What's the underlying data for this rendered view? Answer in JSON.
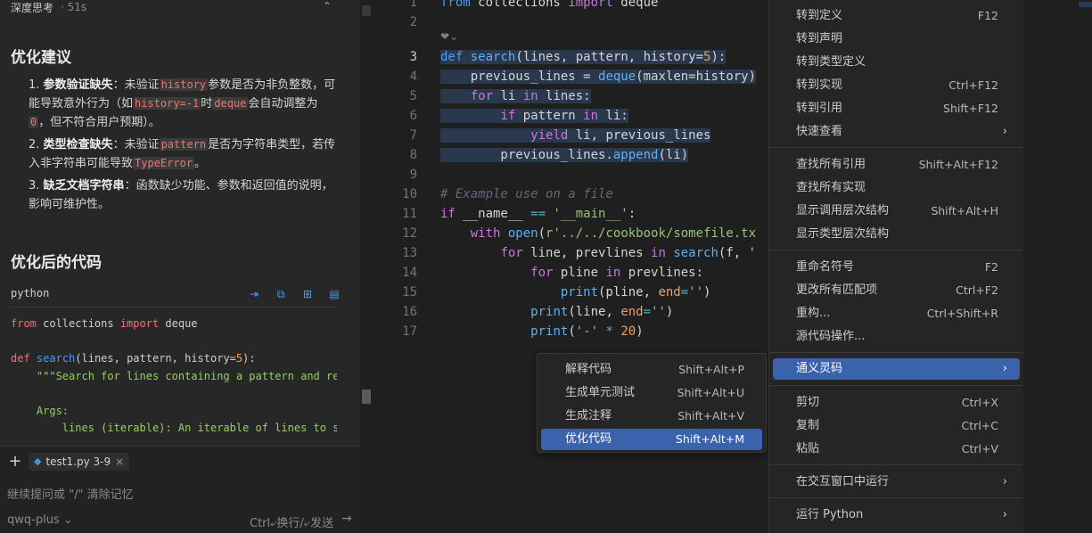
{
  "chat": {
    "thinking_label": "深度思考",
    "thinking_duration": "· 51s",
    "suggestions_heading": "优化建议",
    "suggestions": [
      {
        "num": "1.",
        "title": "参数验证缺失",
        "before": "：未验证",
        "code1": "history",
        "mid1": "参数是否为非负整数，可能导致意外行为（如",
        "code2": "history=-1",
        "mid2": "时",
        "code3": "deque",
        "mid3": "会自动调整为",
        "code4": "0",
        "after": "，但不符合用户预期）。"
      },
      {
        "num": "2.",
        "title": "类型检查缺失",
        "before": "：未验证",
        "code1": "pattern",
        "mid1": "是否为字符串类型，若传入非字符串可能导致",
        "code2": "TypeError",
        "after": "。"
      },
      {
        "num": "3.",
        "title": "缺乏文档字符串",
        "after": "：函数缺少功能、参数和返回值的说明，影响可维护性。"
      }
    ],
    "optimized_heading": "优化后的代码",
    "code_lang": "python",
    "code_lines": {
      "l1a": "from",
      "l1b": " collections ",
      "l1c": "import",
      "l1d": " deque",
      "l3a": "def",
      "l3b": " ",
      "l3c": "search",
      "l3d": "(lines, pattern, history=",
      "l3e": "5",
      "l3f": "):",
      "l4": "    \"\"\"Search for lines containing a pattern and re",
      "l6": "    Args:",
      "l7": "        lines (iterable): An iterable of lines to se"
    },
    "file_chip": "test1.py 3-9",
    "input_placeholder": "继续提问或 \"/\" 清除记忆",
    "model": "qwq-plus",
    "send_hint": "Ctrl⤶换行/⤶发送"
  },
  "editor": {
    "line_numbers": [
      "1",
      "2",
      "",
      "3",
      "4",
      "5",
      "6",
      "7",
      "8",
      "9",
      "10",
      "11",
      "12",
      "13",
      "14",
      "15",
      "16",
      "17"
    ],
    "codelens": "❤︎⌄",
    "lines": {
      "l1": {
        "a": "from",
        "b": " collections ",
        "c": "import",
        "d": " deque"
      },
      "l3": {
        "a": "def",
        "b": " ",
        "c": "search",
        "d": "(lines, pattern, history=",
        "e": "5",
        "f": "):"
      },
      "l4": {
        "a": "    previous_lines = ",
        "b": "deque",
        "c": "(maxlen=history)"
      },
      "l5": {
        "a": "    ",
        "b": "for",
        "c": " li ",
        "d": "in",
        "e": " lines:"
      },
      "l6": {
        "a": "        ",
        "b": "if",
        "c": " pattern ",
        "d": "in",
        "e": " li:"
      },
      "l7": {
        "a": "            ",
        "b": "yield",
        "c": " li, previous_lines"
      },
      "l8": {
        "a": "        previous_lines.",
        "b": "append",
        "c": "(li)"
      },
      "l10": "# Example use on a file",
      "l11": {
        "a": "if",
        "b": " __name__ ",
        "c": "==",
        "d": " ",
        "e": "'__main__'",
        "f": ":"
      },
      "l12": {
        "a": "    ",
        "b": "with",
        "c": " ",
        "d": "open",
        "e": "(",
        "f": "r'../../cookbook/somefile.tx"
      },
      "l13": {
        "a": "        ",
        "b": "for",
        "c": " line, prevlines ",
        "d": "in",
        "e": " ",
        "f": "search",
        "g": "(f, '"
      },
      "l14": {
        "a": "            ",
        "b": "for",
        "c": " pline ",
        "d": "in",
        "e": " prevlines:"
      },
      "l15": {
        "a": "                ",
        "b": "print",
        "c": "(pline, ",
        "d": "end",
        "e": "=",
        "f": "''",
        "g": ")"
      },
      "l16": {
        "a": "            ",
        "b": "print",
        "c": "(line, ",
        "d": "end",
        "e": "=",
        "f": "''",
        "g": ")"
      },
      "l17": {
        "a": "            ",
        "b": "print",
        "c": "(",
        "d": "'-'",
        "e": " * ",
        "f": "20",
        "g": ")"
      }
    }
  },
  "context_menu": {
    "items": [
      {
        "label": "转到定义",
        "key": "F12"
      },
      {
        "label": "转到声明",
        "key": ""
      },
      {
        "label": "转到类型定义",
        "key": ""
      },
      {
        "label": "转到实现",
        "key": "Ctrl+F12"
      },
      {
        "label": "转到引用",
        "key": "Shift+F12"
      },
      {
        "label": "快速查看",
        "key": "›"
      },
      {
        "label": "查找所有引用",
        "key": "Shift+Alt+F12"
      },
      {
        "label": "查找所有实现",
        "key": ""
      },
      {
        "label": "显示调用层次结构",
        "key": "Shift+Alt+H"
      },
      {
        "label": "显示类型层次结构",
        "key": ""
      },
      {
        "label": "重命名符号",
        "key": "F2"
      },
      {
        "label": "更改所有匹配项",
        "key": "Ctrl+F2"
      },
      {
        "label": "重构...",
        "key": "Ctrl+Shift+R"
      },
      {
        "label": "源代码操作...",
        "key": ""
      },
      {
        "label": "通义灵码",
        "key": "›"
      },
      {
        "label": "剪切",
        "key": "Ctrl+X"
      },
      {
        "label": "复制",
        "key": "Ctrl+C"
      },
      {
        "label": "粘贴",
        "key": "Ctrl+V"
      },
      {
        "label": "在交互窗口中运行",
        "key": "›"
      },
      {
        "label": "运行 Python",
        "key": "›"
      }
    ]
  },
  "submenu": {
    "items": [
      {
        "label": "解释代码",
        "key": "Shift+Alt+P"
      },
      {
        "label": "生成单元测试",
        "key": "Shift+Alt+U"
      },
      {
        "label": "生成注释",
        "key": "Shift+Alt+V"
      },
      {
        "label": "优化代码",
        "key": "Shift+Alt+M"
      }
    ]
  }
}
